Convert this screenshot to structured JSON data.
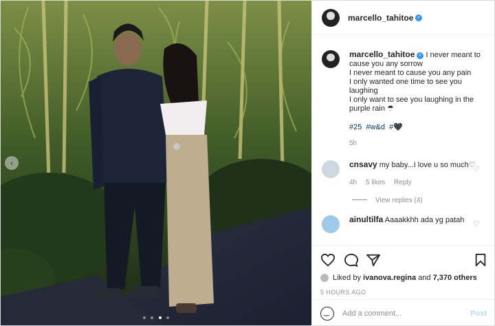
{
  "post": {
    "username": "marcello_tahitoe",
    "verified_icon": "verified-badge-icon",
    "media": {
      "carousel_dots": 4,
      "active_dot": 2
    }
  },
  "caption": {
    "username": "marcello_tahitoe",
    "lines": [
      "I never meant to cause you any sorrow",
      "I never meant to cause you any pain",
      "I only wanted one time to see you laughing",
      "I only want to see you laughing in the purple rain ☂"
    ],
    "tags": [
      "#25",
      "#w&d",
      "#🖤"
    ],
    "time": "5h"
  },
  "comments": [
    {
      "username": "cnsavy",
      "text": "my baby...I love u so much♡",
      "time": "4h",
      "likes": "5 likes",
      "reply_label": "Reply",
      "view_replies": "View replies (4)"
    },
    {
      "username": "ainultilfa",
      "text": "Aaaakkhh ada yg patah"
    }
  ],
  "likes": {
    "prefix": "Liked by",
    "user": "ivanova.regina",
    "middle": "and",
    "others": "7,370 others"
  },
  "timestamp": "5 HOURS AGO",
  "add_comment": {
    "placeholder": "Add a comment...",
    "post_label": "Post"
  },
  "colors": {
    "link": "#00376b",
    "verified": "#3897f0",
    "post_disabled": "#b2dffc",
    "muted": "#8e8e8e"
  }
}
